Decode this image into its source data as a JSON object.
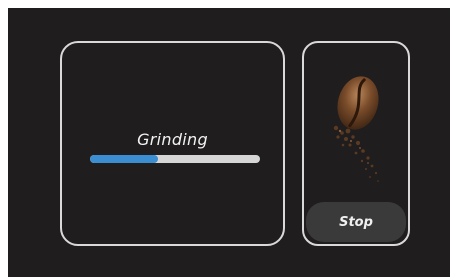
{
  "status": {
    "label": "Grinding",
    "progress_fraction": 0.4
  },
  "controls": {
    "stop_label": "Stop"
  },
  "media": {
    "bean_icon": "coffee-bean-icon"
  },
  "colors": {
    "background": "#1f1d1e",
    "panel_border": "#d9d9d9",
    "progress_fill": "#3b8ed2",
    "progress_track": "#d6d6d6",
    "button_background": "#3b3a3b"
  }
}
